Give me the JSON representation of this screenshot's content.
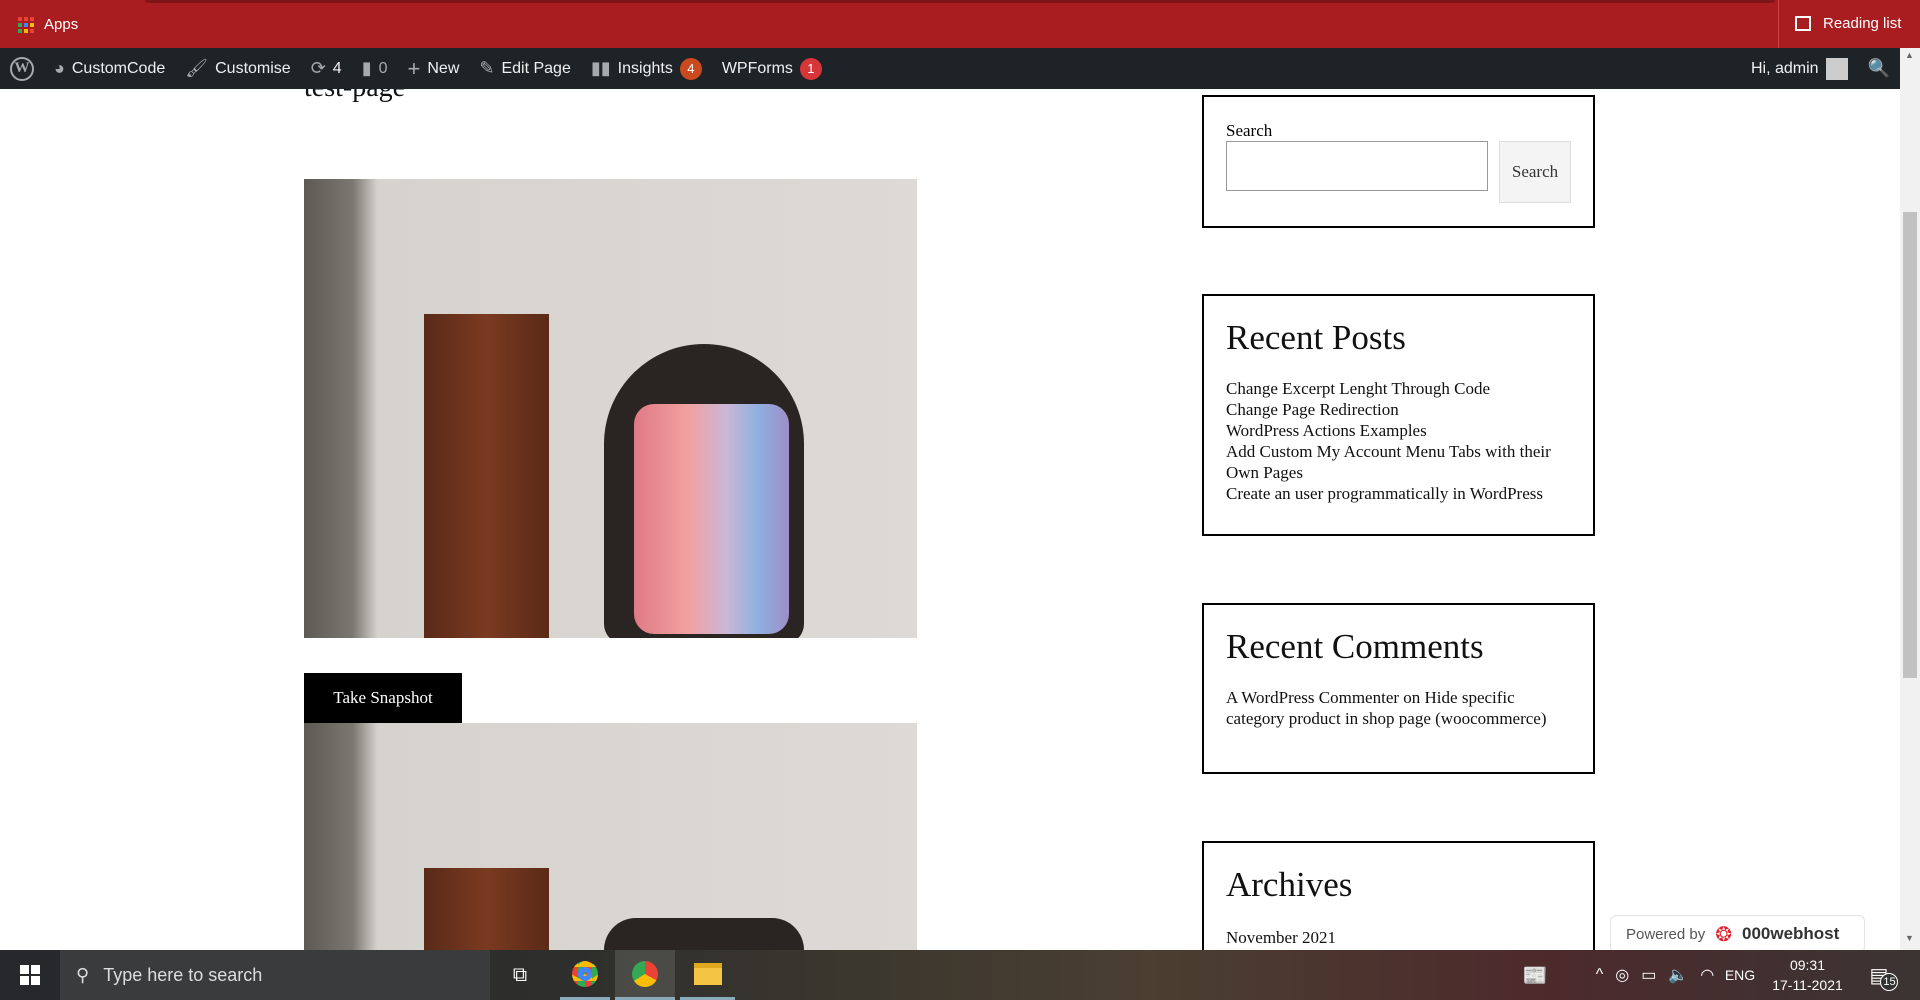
{
  "browser": {
    "apps_label": "Apps",
    "reading_list": "Reading list"
  },
  "adminbar": {
    "site": "CustomCode",
    "customise": "Customise",
    "updates": "4",
    "comments": "0",
    "new": "New",
    "edit": "Edit Page",
    "insights": "Insights",
    "insights_badge": "4",
    "wpforms": "WPForms",
    "wpforms_badge": "1",
    "greeting": "Hi, admin"
  },
  "page": {
    "title": "test-page",
    "snapshot_button": "Take Snapshot"
  },
  "sidebar": {
    "search_label": "Search",
    "search_button": "Search",
    "search_value": "",
    "recent_posts_title": "Recent Posts",
    "recent_posts": [
      "Change Excerpt Lenght Through Code",
      "Change Page Redirection",
      "WordPress Actions Examples",
      "Add Custom My Account Menu Tabs with their Own Pages",
      "Create an user programmatically in WordPress"
    ],
    "recent_comments_title": "Recent Comments",
    "comment": {
      "author": "A WordPress Commenter",
      "on": " on ",
      "post": "Hide specific category product in shop page (woocommerce)"
    },
    "archives_title": "Archives",
    "archives": [
      "November 2021"
    ]
  },
  "powered": {
    "label": "Powered by",
    "brand": "000webhost"
  },
  "taskbar": {
    "search_placeholder": "Type here to search",
    "lang": "ENG",
    "time": "09:31",
    "date": "17-11-2021",
    "notifications": "15"
  },
  "colors": {
    "bookmark_bar": "#a91c1f",
    "admin_bar": "#1d2327",
    "badge": "#d63638"
  }
}
